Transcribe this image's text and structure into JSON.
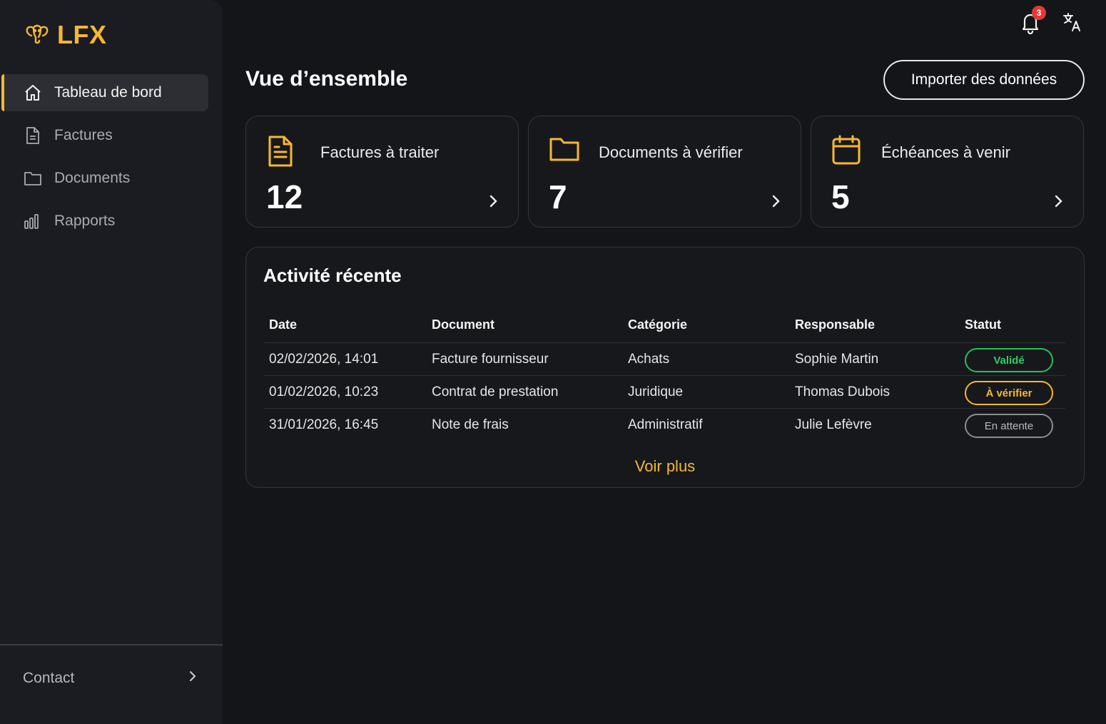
{
  "brand": {
    "name": "LFX",
    "accent": "#f7b733"
  },
  "sidebar": {
    "items": [
      {
        "label": "Tableau de bord",
        "icon": "home-icon",
        "active": true
      },
      {
        "label": "Factures",
        "icon": "file-icon",
        "active": false
      },
      {
        "label": "Documents",
        "icon": "folder-icon",
        "active": false
      },
      {
        "label": "Rapports",
        "icon": "bar-chart-icon",
        "active": false
      }
    ],
    "contact_label": "Contact"
  },
  "topbar": {
    "notification_count": "3"
  },
  "header": {
    "title": "Vue d’ensemble",
    "import_label": "Importer des données"
  },
  "cards": [
    {
      "label": "Factures à traiter",
      "value": "12",
      "icon": "file-text-icon"
    },
    {
      "label": "Documents à vérifier",
      "value": "7",
      "icon": "folder-icon"
    },
    {
      "label": "Échéances à venir",
      "value": "5",
      "icon": "calendar-icon"
    }
  ],
  "activity": {
    "title": "Activité récente",
    "columns": [
      "Date",
      "Document",
      "Catégorie",
      "Responsable",
      "Statut"
    ],
    "rows": [
      {
        "date": "02/02/2026, 14:01",
        "document": "Facture fournisseur",
        "category": "Achats",
        "owner": "Sophie Martin",
        "status": "Validé",
        "status_color": "#27c15a"
      },
      {
        "date": "01/02/2026, 10:23",
        "document": "Contrat de prestation",
        "category": "Juridique",
        "owner": "Thomas Dubois",
        "status": "À vérifier",
        "status_color": "#f7b733"
      },
      {
        "date": "31/01/2026, 16:45",
        "document": "Note de frais",
        "category": "Administratif",
        "owner": "Julie Lefèvre",
        "status": "En attente",
        "status_color": "#8a8d93"
      }
    ],
    "see_more": "Voir plus"
  }
}
